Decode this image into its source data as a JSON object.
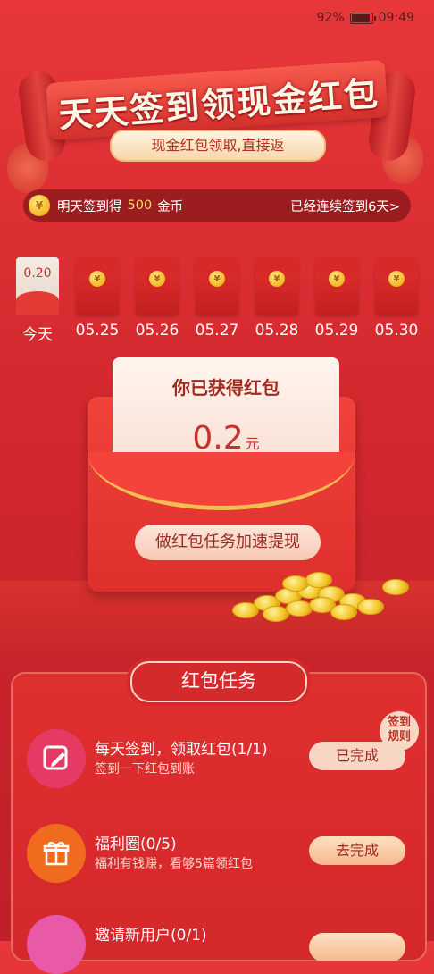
{
  "status": {
    "battery": "92%",
    "time": "09:49"
  },
  "banner": {
    "title": "天天签到领现金红包",
    "subtitle": "现金红包领取,直接返"
  },
  "checkin": {
    "coin_glyph": "¥",
    "tomorrow_prefix": "明天签到得",
    "coins": "500",
    "coin_unit": "金币",
    "streak": "已经连续签到6天>"
  },
  "days": [
    {
      "label": "今天",
      "value": "0.20",
      "opened": true
    },
    {
      "label": "05.25"
    },
    {
      "label": "05.26"
    },
    {
      "label": "05.27"
    },
    {
      "label": "05.28"
    },
    {
      "label": "05.29"
    },
    {
      "label": "05.30"
    }
  ],
  "envelope": {
    "title": "你已获得红包",
    "amount": "0.2",
    "unit": "元",
    "button": "做红包任务加速提现"
  },
  "tasks_section": {
    "title": "红包任务",
    "rules": "签到\n规则"
  },
  "tasks": [
    {
      "title": "每天签到，领取红包(1/1)",
      "subtitle": "签到一下红包到账",
      "button": "已完成",
      "icon": "pencil-edit-icon",
      "color": "#e63a64"
    },
    {
      "title": "福利圈(0/5)",
      "subtitle": "福利有钱赚，看够5篇领红包",
      "button": "去完成",
      "icon": "gift-icon",
      "color": "#f06b1e"
    },
    {
      "title": "邀请新用户(0/1)",
      "subtitle": "",
      "button": "",
      "icon": "invite-icon",
      "color": "#e85aa7"
    }
  ]
}
